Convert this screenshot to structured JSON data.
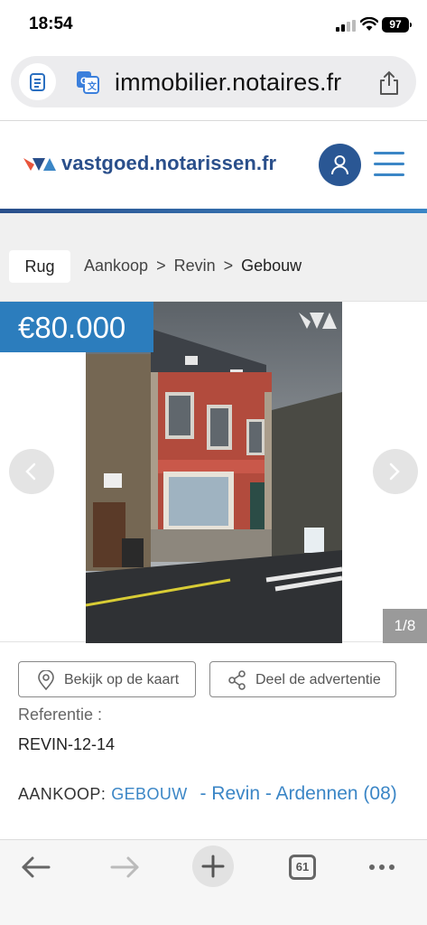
{
  "status_bar": {
    "time": "18:54",
    "battery": "97"
  },
  "browser": {
    "url": "immobilier.notaires.fr",
    "tab_count": "61"
  },
  "site": {
    "logo_text": "vastgoed.notarissen.fr"
  },
  "breadcrumb": {
    "back_label": "Rug",
    "items": [
      "Aankoop",
      "Revin",
      "Gebouw"
    ],
    "separator": ">"
  },
  "gallery": {
    "price": "€80.000",
    "counter": "1/8"
  },
  "actions": {
    "map_label": "Bekijk op de kaart",
    "share_label": "Deel de advertentie"
  },
  "reference": {
    "label": "Referentie :",
    "value": "REVIN-12-14"
  },
  "listing": {
    "kind": "AANKOOP:",
    "type": "GEBOUW",
    "location": " - Revin - Ardennen (08)"
  },
  "colors": {
    "brand_dark": "#2a4f8b",
    "brand_light": "#3b86c6",
    "price_bg": "#2c7dbd"
  }
}
